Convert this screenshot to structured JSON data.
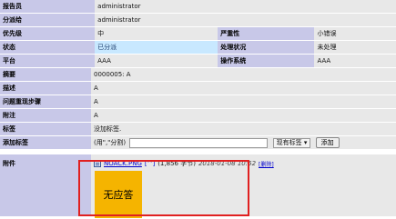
{
  "info": {
    "reporter_label": "报告员",
    "reporter_value": "administrator",
    "assigned_label": "分派给",
    "assigned_value": "administrator",
    "priority_label": "优先级",
    "priority_value": "中",
    "severity_label": "严重性",
    "severity_value": "小错误",
    "status_label": "状态",
    "status_value": "已分派",
    "resolution_label": "处理状况",
    "resolution_value": "未处理",
    "platform_label": "平台",
    "platform_value": "AAA",
    "os_label": "操作系统",
    "os_value": "AAA"
  },
  "details": {
    "summary_label": "摘要",
    "summary_value": "0000005: A",
    "description_label": "描述",
    "description_value": "A",
    "steps_label": "问题重现步骤",
    "steps_value": "A",
    "notes_label": "附注",
    "notes_value": "A",
    "tags_label": "标签",
    "tags_value": "没加标签.",
    "add_tags_label": "添加标签",
    "add_tags_hint": "(用\",\"分割)",
    "existing_tags_label": "现有标签",
    "add_button": "添加"
  },
  "attachment": {
    "label": "附件",
    "filename": "NOACK.PNG",
    "bracket": "[^]",
    "size": "(1,856 字节)",
    "date": "2018-01-08 10:52",
    "delete_label": "[删除]",
    "thumb_text": "无应答"
  },
  "colors": {
    "label_bg": "#c8c8e8",
    "value_bg": "#e8e8e8",
    "status_bg": "#c8e8ff",
    "highlight_box": "#e02020",
    "thumb_bg": "#f5b400"
  }
}
